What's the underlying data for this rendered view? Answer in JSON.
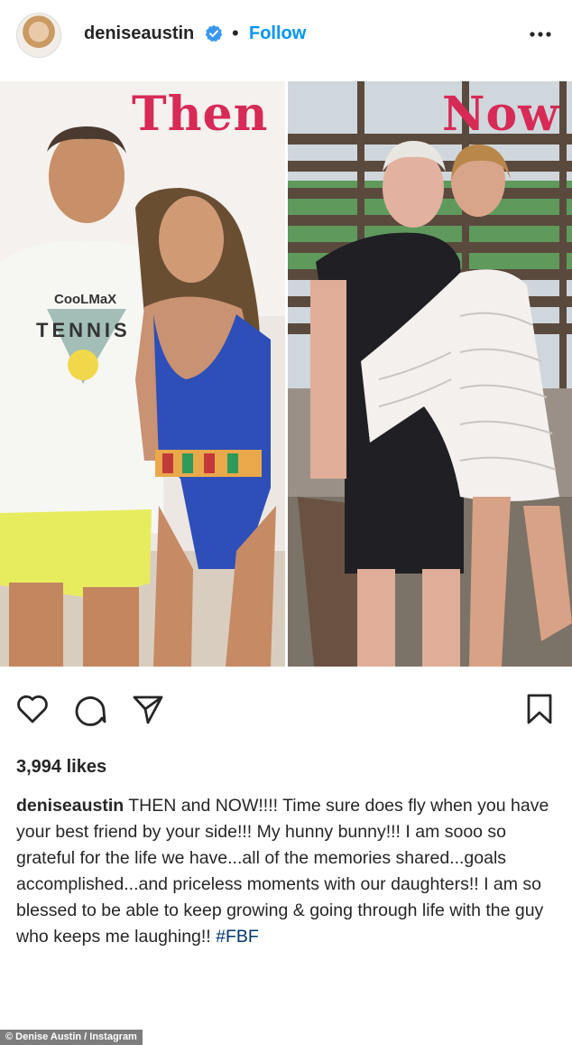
{
  "header": {
    "username": "deniseaustin",
    "separator": "•",
    "follow_label": "Follow",
    "verified_icon": "verified-badge-icon",
    "more_icon": "more-options-icon",
    "avatar_icon": "profile-avatar"
  },
  "photo": {
    "left_label": "Then",
    "right_label": "Now",
    "shirt_text_top": "CooLMaX",
    "shirt_text_bottom": "TENNIS"
  },
  "actions": {
    "like_icon": "heart-icon",
    "comment_icon": "comment-icon",
    "share_icon": "share-icon",
    "save_icon": "bookmark-icon"
  },
  "likes": "3,994 likes",
  "caption": {
    "username": "deniseaustin",
    "text": " THEN and NOW!!!! Time sure does fly when you have your best friend by your side!!! My hunny bunny!!! I am sooo so grateful for the life we have...all of the memories shared...goals accomplished...and priceless moments with our daughters!! I am so blessed to be able to keep growing & going through life with the guy who keeps me laughing!! ",
    "hashtag": "#FBF"
  },
  "credit": "© Denise Austin / Instagram",
  "colors": {
    "follow": "#0095f6",
    "label_pink": "#d72a57",
    "hashtag": "#00376b",
    "text": "#262626"
  }
}
